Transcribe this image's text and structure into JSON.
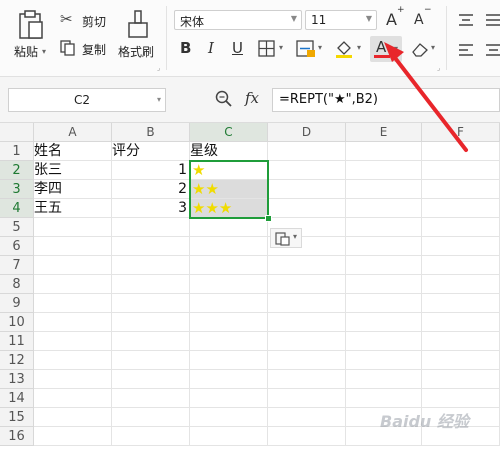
{
  "ribbon": {
    "paste_label": "粘贴",
    "cut_label": "剪切",
    "copy_label": "复制",
    "format_painter_label": "格式刷",
    "font_name": "宋体",
    "font_size": "11",
    "bold": "B",
    "italic": "I",
    "underline": "U",
    "increase_font": "A",
    "decrease_font": "A"
  },
  "formula_bar": {
    "name_box": "C2",
    "fx_label": "fx",
    "formula": "=REPT(\"★\",B2)"
  },
  "columns": [
    "A",
    "B",
    "C",
    "D",
    "E",
    "F"
  ],
  "rows": [
    "1",
    "2",
    "3",
    "4",
    "5",
    "6",
    "7",
    "8",
    "9",
    "10",
    "11",
    "12",
    "13",
    "14",
    "15",
    "16"
  ],
  "cells": {
    "A1": "姓名",
    "B1": "评分",
    "C1": "星级",
    "A2": "张三",
    "B2": "1",
    "C2": "★",
    "A3": "李四",
    "B3": "2",
    "C3": "★★",
    "A4": "王五",
    "B4": "3",
    "C4": "★★★"
  },
  "colors": {
    "selection": "#1f9d3a",
    "star": "#f0dc00",
    "arrow": "#e8262b",
    "selected_header_bg": "#dfe6df"
  },
  "watermark": "Baidu 经验"
}
